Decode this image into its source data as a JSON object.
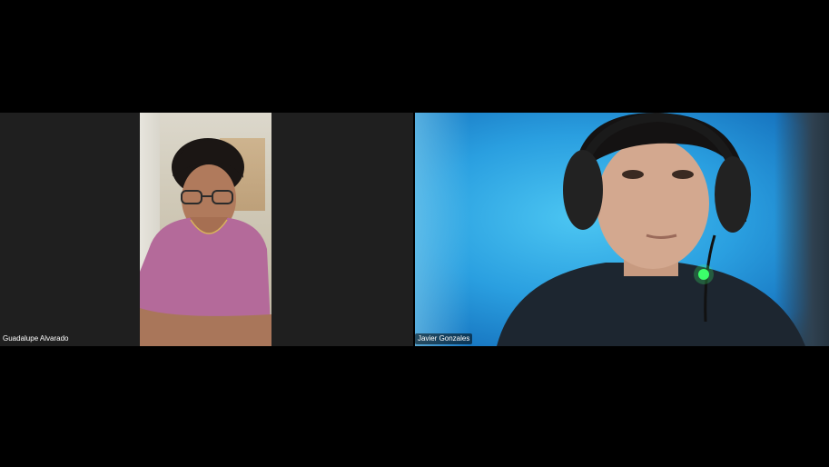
{
  "meeting": {
    "participants": [
      {
        "name": "Guadalupe Alvarado"
      },
      {
        "name": "Javier Gonzales"
      }
    ]
  },
  "colors": {
    "background": "#000000",
    "tile_left_bg": "#1f1f1f",
    "label_text": "#ffffff"
  }
}
